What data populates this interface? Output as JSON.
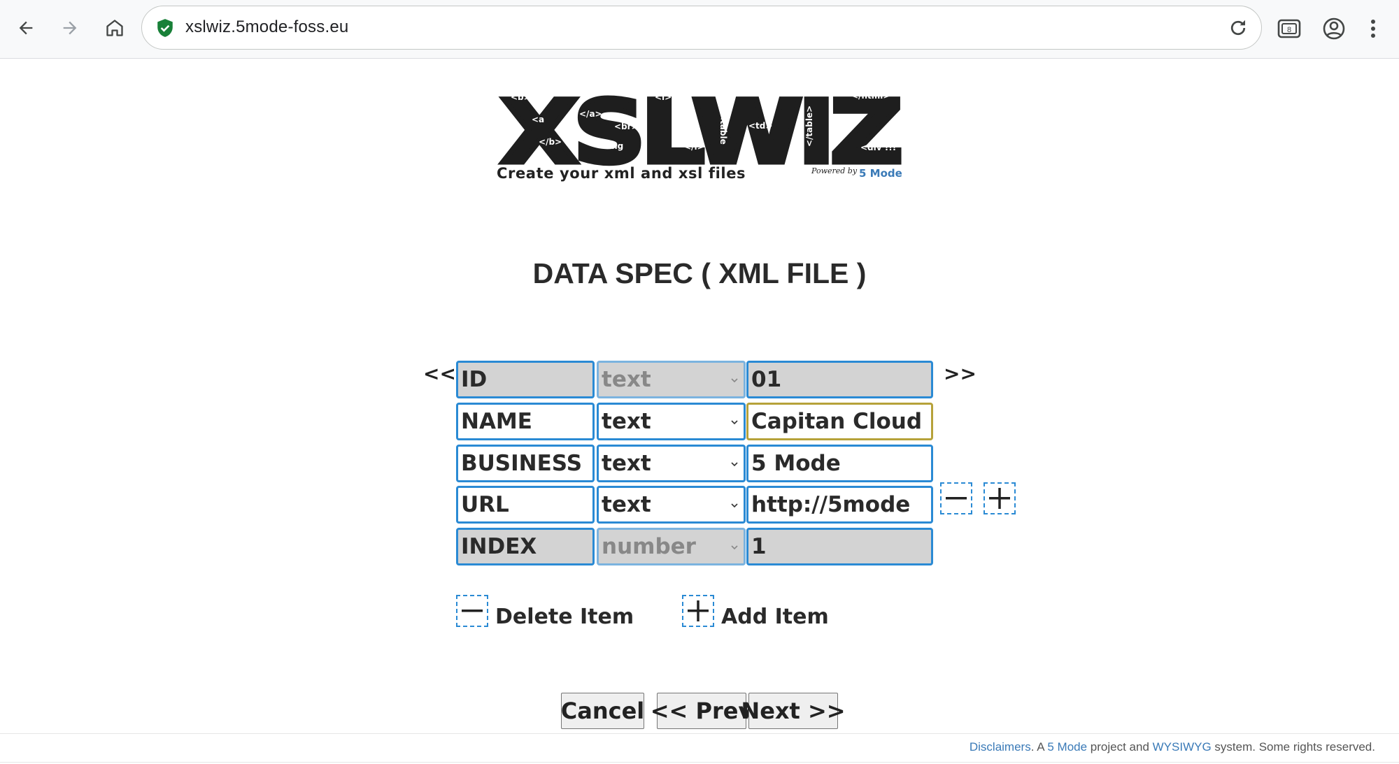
{
  "browser": {
    "url": "xslwiz.5mode-foss.eu",
    "tab_count": "8"
  },
  "logo": {
    "wordmark": "XSLWIZ",
    "tags": [
      "<b>",
      "<a",
      "</b>",
      "</a>",
      "<br>",
      "<img",
      "<i>",
      "</i>",
      "<table",
      "<td>",
      "</table>",
      "</html>",
      "<div !!!"
    ]
  },
  "tagline": "Create your xml and xsl files",
  "powered_by": "Powered by",
  "powered_brand": "5 Mode",
  "page_title": "DATA SPEC ( XML FILE )",
  "pager": {
    "prev": "<<",
    "next": ">>"
  },
  "fields": [
    {
      "name": "ID",
      "type": "text",
      "value": "01"
    },
    {
      "name": "NAME",
      "type": "text",
      "value": "Capitan Cloud"
    },
    {
      "name": "BUSINESS",
      "type": "text",
      "value": "5 Mode"
    },
    {
      "name": "URL",
      "type": "text",
      "value": "http://5mode"
    },
    {
      "name": "INDEX",
      "type": "number",
      "value": "1"
    }
  ],
  "items": {
    "delete_label": "Delete Item",
    "add_label": "Add Item"
  },
  "actions": {
    "cancel": "Cancel",
    "prev": "<< Prev",
    "next": "Next >>"
  },
  "footer": {
    "disclaimers": "Disclaimers",
    "sep1": ". A ",
    "brand": "5 Mode",
    "mid": " project and ",
    "wysiwyg": "WYSIWYG",
    "end": " system. Some rights reserved."
  },
  "colors": {
    "field_border": "#2a8ad4",
    "locked_bg": "#d3d3d3",
    "focus_border": "#b6a23a",
    "link": "#3a7ab7"
  }
}
